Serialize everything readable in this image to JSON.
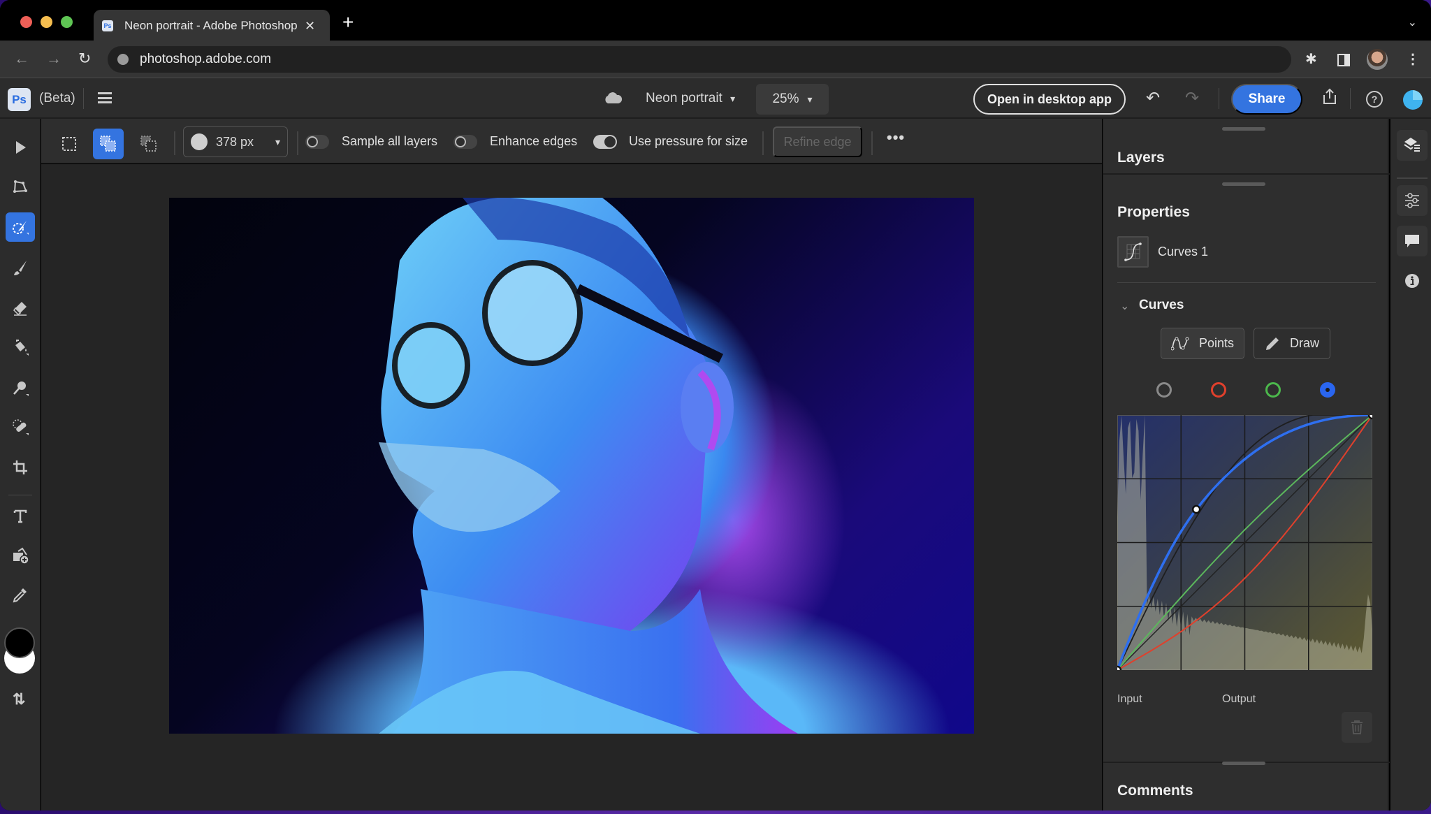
{
  "browser": {
    "tab_title": "Neon portrait - Adobe Photoshop",
    "tab_favicon": "Ps",
    "url": "photoshop.adobe.com"
  },
  "app": {
    "logo": "Ps",
    "beta_label": "(Beta)",
    "document_name": "Neon portrait",
    "zoom_level": "25%",
    "open_desktop_label": "Open in desktop app",
    "share_label": "Share",
    "help_glyph": "?",
    "accent_color": "#3474e0"
  },
  "options": {
    "brush_size": "378 px",
    "toggles": [
      {
        "label": "Sample all layers",
        "on": false
      },
      {
        "label": "Enhance edges",
        "on": false
      },
      {
        "label": "Use pressure for size",
        "on": true
      }
    ],
    "refine_edge_label": "Refine edge",
    "more_glyph": "•••"
  },
  "tools": [
    {
      "name": "move",
      "active": false
    },
    {
      "name": "lasso",
      "active": false
    },
    {
      "name": "quick-selection",
      "active": true
    },
    {
      "name": "brush",
      "active": false
    },
    {
      "name": "eraser",
      "active": false
    },
    {
      "name": "paint-bucket",
      "active": false
    },
    {
      "name": "dodge",
      "active": false
    },
    {
      "name": "healing",
      "active": false
    },
    {
      "name": "crop",
      "active": false
    },
    {
      "name": "type",
      "active": false
    },
    {
      "name": "place-image",
      "active": false
    },
    {
      "name": "eyedropper",
      "active": false
    }
  ],
  "colors": {
    "foreground": "#000000",
    "background": "#ffffff"
  },
  "panels": {
    "layers_title": "Layers",
    "properties_title": "Properties",
    "layer_name": "Curves 1",
    "curves_title": "Curves",
    "points_label": "Points",
    "draw_label": "Draw",
    "channels": [
      {
        "name": "rgb",
        "color": "#8a8a8a",
        "selected": false
      },
      {
        "name": "red",
        "color": "#e0402c",
        "selected": false
      },
      {
        "name": "green",
        "color": "#4cb84c",
        "selected": false
      },
      {
        "name": "blue",
        "color": "#2a66f0",
        "selected": true
      }
    ],
    "input_label": "Input",
    "output_label": "Output",
    "comments_title": "Comments"
  },
  "curves": {
    "blue_points": [
      [
        0,
        0
      ],
      [
        0.31,
        0.63
      ],
      [
        1,
        1
      ]
    ],
    "rgb_curve_strength": 0.35,
    "green_curve_strength": 0.05,
    "red_curve_strength": -0.14
  }
}
